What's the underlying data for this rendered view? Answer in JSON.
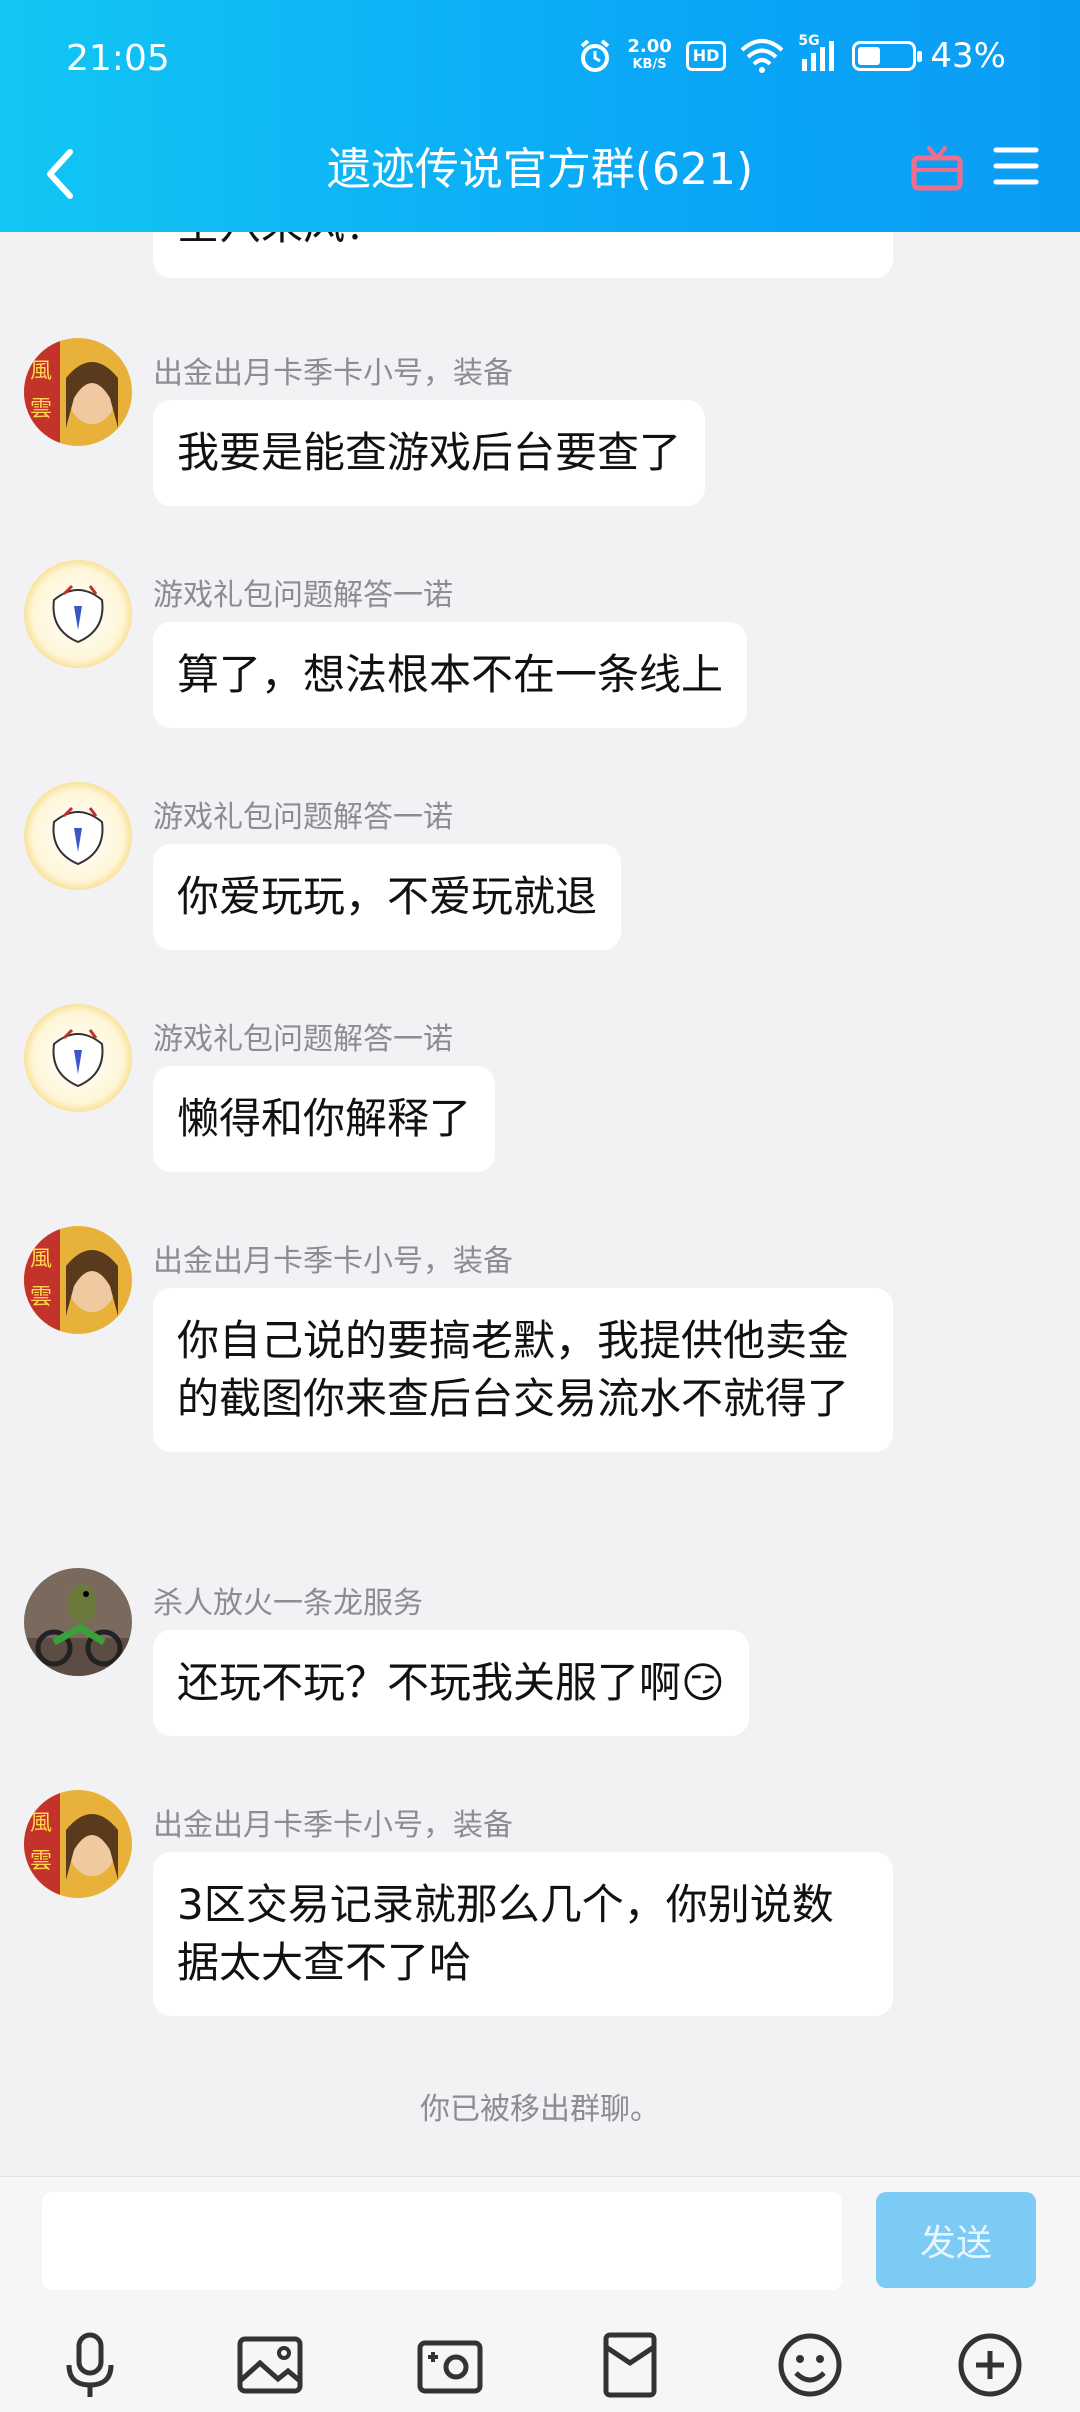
{
  "status_bar": {
    "time": "21:05",
    "net_speed_value": "2.00",
    "net_speed_unit": "KB/S",
    "hd_label": "HD",
    "network_label": "5G",
    "battery_percent": "43%",
    "battery_level": 0.43
  },
  "header": {
    "title": "遗迹传说官方群(621)"
  },
  "messages": [
    {
      "sender": "",
      "text": "空穴来风？",
      "avatar": "avatar-fengyun"
    },
    {
      "sender": "出金出月卡季卡小号，装备",
      "text": "我要是能查游戏后台要查了",
      "avatar": "avatar-fengyun"
    },
    {
      "sender": "游戏礼包问题解答一诺",
      "text": "算了，想法根本不在一条线上",
      "avatar": "avatar-cartoon"
    },
    {
      "sender": "游戏礼包问题解答一诺",
      "text": "你爱玩玩，不爱玩就退",
      "avatar": "avatar-cartoon"
    },
    {
      "sender": "游戏礼包问题解答一诺",
      "text": "懒得和你解释了",
      "avatar": "avatar-cartoon"
    },
    {
      "sender": "出金出月卡季卡小号，装备",
      "text": "你自己说的要搞老默，我提供他卖金的截图你来查后台交易流水不就得了",
      "avatar": "avatar-fengyun"
    },
    {
      "sender": "杀人放火一条龙服务",
      "text": "还玩不玩？不玩我关服了啊😏",
      "avatar": "avatar-lizard"
    },
    {
      "sender": "出金出月卡季卡小号，装备",
      "text": "3区交易记录就那么几个，你别说数据太大查不了哈",
      "avatar": "avatar-fengyun"
    }
  ],
  "system_note": "你已被移出群聊。",
  "input": {
    "placeholder": "",
    "value": "",
    "send_label": "发送"
  },
  "toolbar": [
    "microphone-icon",
    "picture-icon",
    "camera-icon",
    "red-packet-icon",
    "emoji-icon",
    "plus-icon"
  ],
  "colors": {
    "header_start": "#12c6f4",
    "header_end": "#0b9cf5",
    "send_button": "#7ccbf5",
    "background": "#f2f2f4"
  }
}
